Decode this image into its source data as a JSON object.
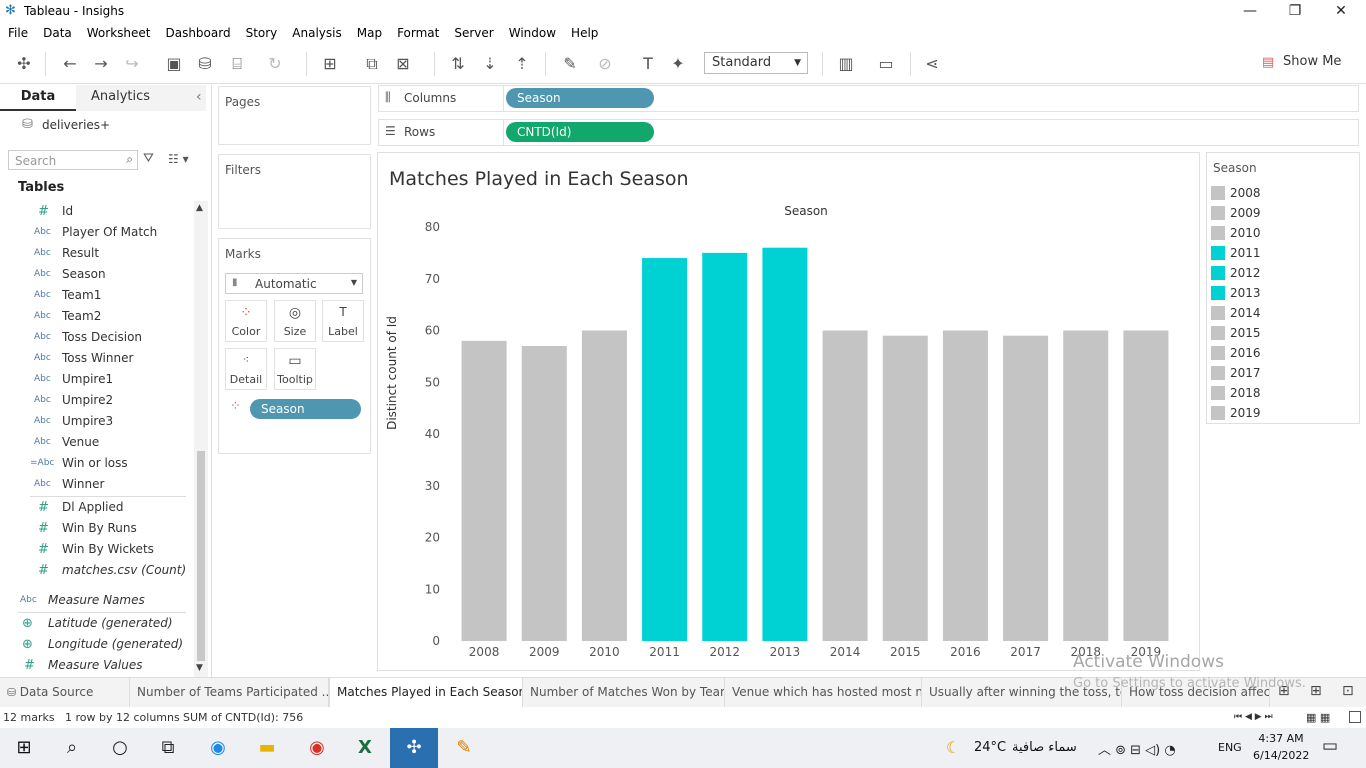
{
  "window": {
    "title": "Tableau - Insighs",
    "min": "—",
    "max": "❐",
    "close": "✕"
  },
  "menu": [
    "File",
    "Data",
    "Worksheet",
    "Dashboard",
    "Story",
    "Analysis",
    "Map",
    "Format",
    "Server",
    "Window",
    "Help"
  ],
  "toolbar": {
    "standard_label": "Standard",
    "show_me_label": "Show Me"
  },
  "left_pane": {
    "tab_data": "Data",
    "tab_analytics": "Analytics",
    "collapse": "‹",
    "datasource": "deliveries+",
    "search_placeholder": "Search",
    "tables_heading": "Tables",
    "fields": [
      {
        "icon": "#",
        "name": "Id"
      },
      {
        "icon": "Abc",
        "name": "Player Of Match"
      },
      {
        "icon": "Abc",
        "name": "Result"
      },
      {
        "icon": "Abc",
        "name": "Season"
      },
      {
        "icon": "Abc",
        "name": "Team1"
      },
      {
        "icon": "Abc",
        "name": "Team2"
      },
      {
        "icon": "Abc",
        "name": "Toss Decision"
      },
      {
        "icon": "Abc",
        "name": "Toss Winner"
      },
      {
        "icon": "Abc",
        "name": "Umpire1"
      },
      {
        "icon": "Abc",
        "name": "Umpire2"
      },
      {
        "icon": "Abc",
        "name": "Umpire3"
      },
      {
        "icon": "Abc",
        "name": "Venue"
      },
      {
        "icon": "=Abc",
        "name": "Win or loss"
      },
      {
        "icon": "Abc",
        "name": "Winner"
      }
    ],
    "measures": [
      {
        "icon": "#",
        "name": "Dl Applied"
      },
      {
        "icon": "#",
        "name": "Win By Runs"
      },
      {
        "icon": "#",
        "name": "Win By Wickets"
      },
      {
        "icon": "#",
        "name": "matches.csv (Count)"
      }
    ],
    "extra": [
      {
        "icon": "Abc",
        "name": "Measure Names"
      },
      {
        "icon": "⊕",
        "name": "Latitude (generated)"
      },
      {
        "icon": "⊕",
        "name": "Longitude (generated)"
      },
      {
        "icon": "#",
        "name": "Measure Values"
      }
    ]
  },
  "cards": {
    "pages": "Pages",
    "filters": "Filters",
    "marks": "Marks",
    "mark_type": "Automatic",
    "btn_color": "Color",
    "btn_size": "Size",
    "btn_label": "Label",
    "btn_detail": "Detail",
    "btn_tooltip": "Tooltip",
    "marks_pill": "Season"
  },
  "shelves": {
    "columns_label": "Columns",
    "columns_pill": "Season",
    "rows_label": "Rows",
    "rows_pill": "CNTD(Id)"
  },
  "chart_data": {
    "type": "bar",
    "title": "Matches Played in Each Season",
    "xlabel": "Season",
    "ylabel": "Distinct count of Id",
    "ylim": [
      0,
      80
    ],
    "yticks": [
      0,
      10,
      20,
      30,
      40,
      50,
      60,
      70,
      80
    ],
    "categories": [
      "2008",
      "2009",
      "2010",
      "2011",
      "2012",
      "2013",
      "2014",
      "2015",
      "2016",
      "2017",
      "2018",
      "2019"
    ],
    "values": [
      58,
      57,
      60,
      74,
      75,
      76,
      60,
      59,
      60,
      59,
      60,
      60
    ],
    "highlighted": [
      "2011",
      "2012",
      "2013"
    ],
    "colors": {
      "highlight": "#00d2d3",
      "default": "#c4c4c4"
    }
  },
  "legend": {
    "title": "Season",
    "items": [
      {
        "label": "2008",
        "color": "#c4c4c4"
      },
      {
        "label": "2009",
        "color": "#c4c4c4"
      },
      {
        "label": "2010",
        "color": "#c4c4c4"
      },
      {
        "label": "2011",
        "color": "#00d2d3"
      },
      {
        "label": "2012",
        "color": "#00d2d3"
      },
      {
        "label": "2013",
        "color": "#00d2d3"
      },
      {
        "label": "2014",
        "color": "#c4c4c4"
      },
      {
        "label": "2015",
        "color": "#c4c4c4"
      },
      {
        "label": "2016",
        "color": "#c4c4c4"
      },
      {
        "label": "2017",
        "color": "#c4c4c4"
      },
      {
        "label": "2018",
        "color": "#c4c4c4"
      },
      {
        "label": "2019",
        "color": "#c4c4c4"
      }
    ]
  },
  "sheet_tabs": [
    {
      "label": "Data Source",
      "active": false
    },
    {
      "label": "Number of Teams Participated ...",
      "active": false
    },
    {
      "label": "Matches Played in Each Season",
      "active": true
    },
    {
      "label": "Number of Matches Won by Team",
      "active": false
    },
    {
      "label": "Venue which has hosted most n...",
      "active": false
    },
    {
      "label": "Usually after winning the toss, te...",
      "active": false
    },
    {
      "label": "How toss decision affects",
      "active": false
    }
  ],
  "status": {
    "marks": "12 marks",
    "rows_cols": "1 row by 12 columns",
    "sum": "SUM of CNTD(Id): 756"
  },
  "watermark": {
    "line1": "Activate Windows",
    "line2": "Go to Settings to activate Windows."
  },
  "taskbar": {
    "weather": "24°C",
    "weather_text": "سماء صافية",
    "lang": "ENG",
    "time": "4:37 AM",
    "date": "6/14/2022"
  }
}
